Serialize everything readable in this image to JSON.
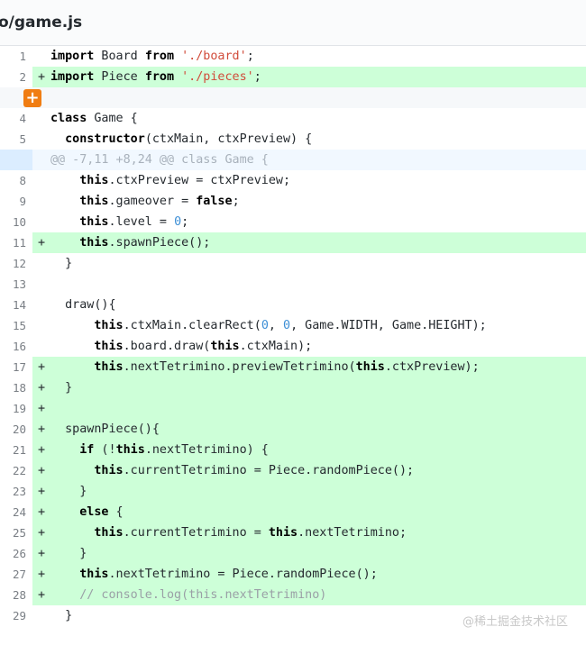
{
  "file": {
    "path": "o/game.js"
  },
  "expand_icon": "plus-icon",
  "watermark": "@稀土掘金技术社区",
  "lines": [
    {
      "num": "1",
      "type": "context",
      "marker": "",
      "tokens": [
        {
          "t": "import",
          "c": "kw"
        },
        {
          "t": " Board "
        },
        {
          "t": "from",
          "c": "kw"
        },
        {
          "t": " "
        },
        {
          "t": "'./board'",
          "c": "str"
        },
        {
          "t": ";"
        }
      ]
    },
    {
      "num": "2",
      "type": "added",
      "marker": "+",
      "tokens": [
        {
          "t": "import",
          "c": "kw"
        },
        {
          "t": " Piece "
        },
        {
          "t": "from",
          "c": "kw"
        },
        {
          "t": " "
        },
        {
          "t": "'./pieces'",
          "c": "str"
        },
        {
          "t": ";"
        }
      ]
    },
    {
      "num": "",
      "type": "blank",
      "marker": "",
      "tokens": []
    },
    {
      "num": "4",
      "type": "context",
      "marker": "",
      "tokens": [
        {
          "t": "class",
          "c": "kw"
        },
        {
          "t": " Game {"
        }
      ]
    },
    {
      "num": "5",
      "type": "context",
      "marker": "",
      "tokens": [
        {
          "t": "  "
        },
        {
          "t": "constructor",
          "c": "kw"
        },
        {
          "t": "(ctxMain, ctxPreview) {"
        }
      ]
    },
    {
      "num": "",
      "type": "hunk",
      "marker": "",
      "tokens": [
        {
          "t": "@@ -7,11 +8,24 @@ class Game {"
        }
      ]
    },
    {
      "num": "8",
      "type": "context",
      "marker": "",
      "tokens": [
        {
          "t": "    "
        },
        {
          "t": "this",
          "c": "kw"
        },
        {
          "t": ".ctxPreview = ctxPreview;"
        }
      ]
    },
    {
      "num": "9",
      "type": "context",
      "marker": "",
      "tokens": [
        {
          "t": "    "
        },
        {
          "t": "this",
          "c": "kw"
        },
        {
          "t": ".gameover = "
        },
        {
          "t": "false",
          "c": "kw"
        },
        {
          "t": ";"
        }
      ]
    },
    {
      "num": "10",
      "type": "context",
      "marker": "",
      "tokens": [
        {
          "t": "    "
        },
        {
          "t": "this",
          "c": "kw"
        },
        {
          "t": ".level = "
        },
        {
          "t": "0",
          "c": "numlit"
        },
        {
          "t": ";"
        }
      ]
    },
    {
      "num": "11",
      "type": "added",
      "marker": "+",
      "tokens": [
        {
          "t": "    "
        },
        {
          "t": "this",
          "c": "kw"
        },
        {
          "t": ".spawnPiece();"
        }
      ]
    },
    {
      "num": "12",
      "type": "context",
      "marker": "",
      "tokens": [
        {
          "t": "  }"
        }
      ]
    },
    {
      "num": "13",
      "type": "context",
      "marker": "",
      "tokens": []
    },
    {
      "num": "14",
      "type": "context",
      "marker": "",
      "tokens": [
        {
          "t": "  draw(){"
        }
      ]
    },
    {
      "num": "15",
      "type": "context",
      "marker": "",
      "tokens": [
        {
          "t": "      "
        },
        {
          "t": "this",
          "c": "kw"
        },
        {
          "t": ".ctxMain.clearRect("
        },
        {
          "t": "0",
          "c": "numlit"
        },
        {
          "t": ", "
        },
        {
          "t": "0",
          "c": "numlit"
        },
        {
          "t": ", Game.WIDTH, Game.HEIGHT);"
        }
      ]
    },
    {
      "num": "16",
      "type": "context",
      "marker": "",
      "tokens": [
        {
          "t": "      "
        },
        {
          "t": "this",
          "c": "kw"
        },
        {
          "t": ".board.draw("
        },
        {
          "t": "this",
          "c": "kw"
        },
        {
          "t": ".ctxMain);"
        }
      ]
    },
    {
      "num": "17",
      "type": "added",
      "marker": "+",
      "tokens": [
        {
          "t": "      "
        },
        {
          "t": "this",
          "c": "kw"
        },
        {
          "t": ".nextTetrimino.previewTetrimino("
        },
        {
          "t": "this",
          "c": "kw"
        },
        {
          "t": ".ctxPreview);"
        }
      ]
    },
    {
      "num": "18",
      "type": "added",
      "marker": "+",
      "tokens": [
        {
          "t": "  }"
        }
      ]
    },
    {
      "num": "19",
      "type": "added",
      "marker": "+",
      "tokens": []
    },
    {
      "num": "20",
      "type": "added",
      "marker": "+",
      "tokens": [
        {
          "t": "  spawnPiece(){"
        }
      ]
    },
    {
      "num": "21",
      "type": "added",
      "marker": "+",
      "tokens": [
        {
          "t": "    "
        },
        {
          "t": "if",
          "c": "kw"
        },
        {
          "t": " (!"
        },
        {
          "t": "this",
          "c": "kw"
        },
        {
          "t": ".nextTetrimino) {"
        }
      ]
    },
    {
      "num": "22",
      "type": "added",
      "marker": "+",
      "tokens": [
        {
          "t": "      "
        },
        {
          "t": "this",
          "c": "kw"
        },
        {
          "t": ".currentTetrimino = Piece.randomPiece();"
        }
      ]
    },
    {
      "num": "23",
      "type": "added",
      "marker": "+",
      "tokens": [
        {
          "t": "    }"
        }
      ]
    },
    {
      "num": "24",
      "type": "added",
      "marker": "+",
      "tokens": [
        {
          "t": "    "
        },
        {
          "t": "else",
          "c": "kw"
        },
        {
          "t": " {"
        }
      ]
    },
    {
      "num": "25",
      "type": "added",
      "marker": "+",
      "tokens": [
        {
          "t": "      "
        },
        {
          "t": "this",
          "c": "kw"
        },
        {
          "t": ".currentTetrimino = "
        },
        {
          "t": "this",
          "c": "kw"
        },
        {
          "t": ".nextTetrimino;"
        }
      ]
    },
    {
      "num": "26",
      "type": "added",
      "marker": "+",
      "tokens": [
        {
          "t": "    }"
        }
      ]
    },
    {
      "num": "27",
      "type": "added",
      "marker": "+",
      "tokens": [
        {
          "t": "    "
        },
        {
          "t": "this",
          "c": "kw"
        },
        {
          "t": ".nextTetrimino = Piece.randomPiece();"
        }
      ]
    },
    {
      "num": "28",
      "type": "added",
      "marker": "+",
      "tokens": [
        {
          "t": "    "
        },
        {
          "t": "// console.log(this.nextTetrimino)",
          "c": "cmt"
        }
      ]
    },
    {
      "num": "29",
      "type": "context",
      "marker": "",
      "tokens": [
        {
          "t": "  }"
        }
      ]
    }
  ]
}
